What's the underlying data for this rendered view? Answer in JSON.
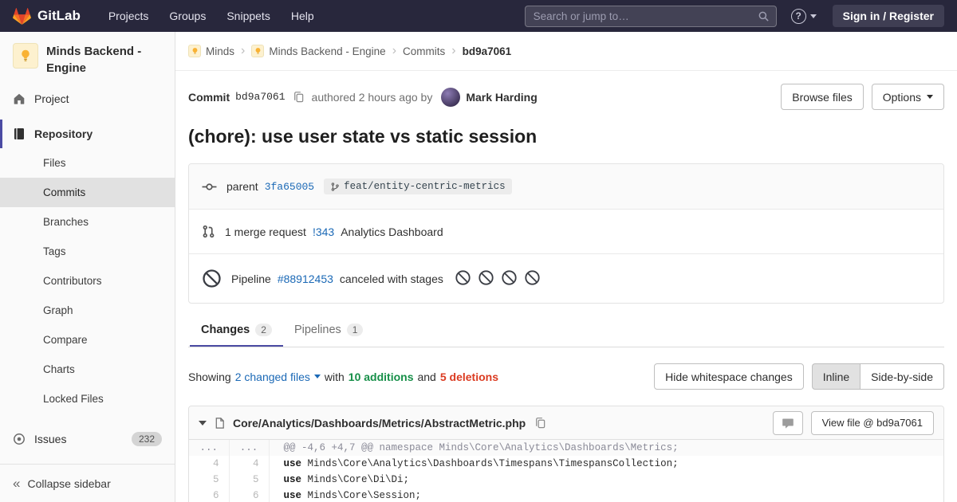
{
  "navbar": {
    "brand": "GitLab",
    "menu": [
      "Projects",
      "Groups",
      "Snippets",
      "Help"
    ],
    "search_placeholder": "Search or jump to…",
    "sign_in": "Sign in / Register"
  },
  "icons": {
    "help_glyph": "?",
    "collapse_glyph": "«",
    "breadcrumb_sep": "›"
  },
  "sidebar": {
    "project_title": "Minds Backend - Engine",
    "project": "Project",
    "repository": "Repository",
    "repo_subitems": [
      "Files",
      "Commits",
      "Branches",
      "Tags",
      "Contributors",
      "Graph",
      "Compare",
      "Charts",
      "Locked Files"
    ],
    "issues": "Issues",
    "issues_count": "232",
    "collapse": "Collapse sidebar"
  },
  "breadcrumb": {
    "items": [
      "Minds",
      "Minds Backend - Engine",
      "Commits",
      "bd9a7061"
    ]
  },
  "commit": {
    "label": "Commit",
    "sha": "bd9a7061",
    "authored": "authored 2 hours ago by",
    "author": "Mark Harding",
    "browse_files": "Browse files",
    "options": "Options",
    "title": "(chore): use user state vs static session",
    "parent_label": "parent",
    "parent_sha": "3fa65005",
    "branch": "feat/entity-centric-metrics",
    "mr_count": "1 merge request",
    "mr_id": "!343",
    "mr_title": "Analytics Dashboard",
    "pipeline_label": "Pipeline",
    "pipeline_id": "#88912453",
    "pipeline_status": "canceled with stages",
    "stages": 4
  },
  "tabs": {
    "changes": "Changes",
    "changes_count": "2",
    "pipelines": "Pipelines",
    "pipelines_count": "1"
  },
  "diffbar": {
    "showing": "Showing",
    "changed_files": "2 changed files",
    "with_text": "with",
    "additions": "10 additions",
    "and_text": "and",
    "deletions": "5 deletions",
    "hide_whitespace": "Hide whitespace changes",
    "inline": "Inline",
    "side_by_side": "Side-by-side"
  },
  "file": {
    "path": "Core/Analytics/Dashboards/Metrics/AbstractMetric.php",
    "view_file": "View file @ bd9a7061"
  },
  "diff": {
    "meta": {
      "old": "...",
      "new": "...",
      "text": "@@ -4,6 +4,7 @@ namespace Minds\\Core\\Analytics\\Dashboards\\Metrics;"
    },
    "rows": [
      {
        "old": "4",
        "new": "4",
        "keyword": "use",
        "code": " Minds\\Core\\Analytics\\Dashboards\\Timespans\\TimespansCollection;"
      },
      {
        "old": "5",
        "new": "5",
        "keyword": "use",
        "code": " Minds\\Core\\Di\\Di;"
      },
      {
        "old": "6",
        "new": "6",
        "keyword": "use",
        "code": " Minds\\Core\\Session;"
      }
    ]
  },
  "colors": {
    "navbar": "#28273c",
    "accent": "#4b4ba3",
    "link": "#1b69b6",
    "added": "#168f48",
    "removed": "#db3b21"
  }
}
